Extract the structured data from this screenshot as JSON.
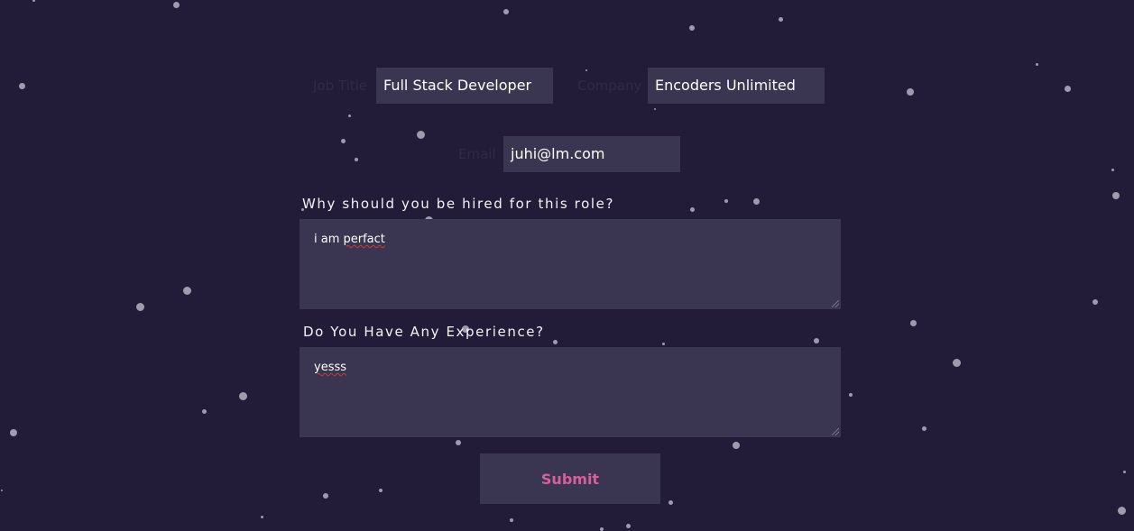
{
  "form": {
    "job_title_label": "Job Title",
    "job_title_value": "Full Stack Developer",
    "company_label": "Company",
    "company_value": "Encoders Unlimited",
    "email_label": "Email",
    "email_value": "juhi@lm.com",
    "question_1": "Why should you be hired for this role?",
    "answer_1_word1": "i am ",
    "answer_1_word2": "perfact",
    "question_2": "Do You Have Any Experience?",
    "answer_2": "yesss",
    "submit_label": "Submit"
  },
  "colors": {
    "background": "#221c39",
    "field": "#3a3550",
    "accent": "#d6609a",
    "dots": "#a7a2b4"
  }
}
